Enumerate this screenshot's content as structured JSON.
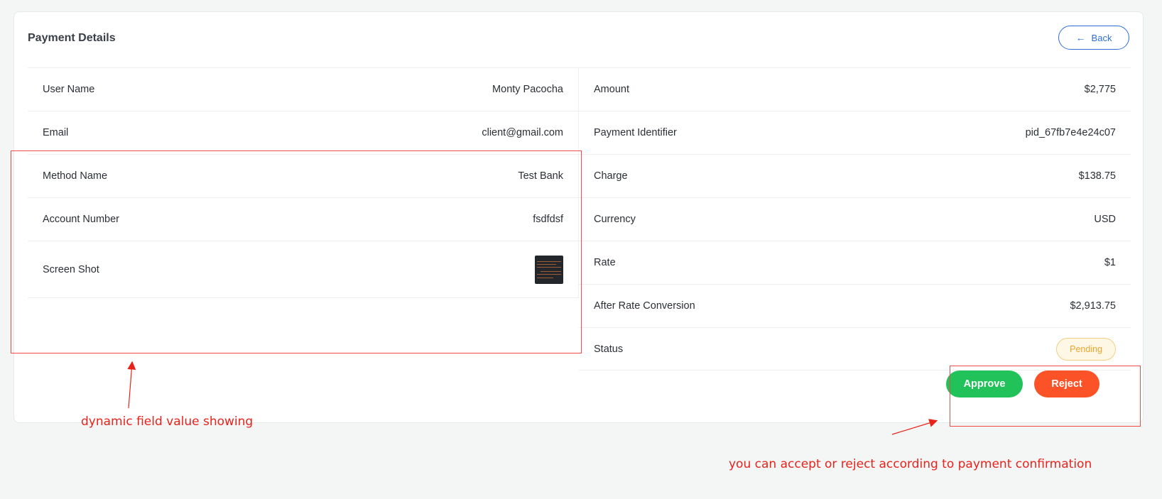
{
  "card": {
    "title": "Payment Details",
    "back_label": "Back"
  },
  "left_fields": [
    {
      "label": "User Name",
      "value": "Monty Pacocha"
    },
    {
      "label": "Email",
      "value": "client@gmail.com"
    },
    {
      "label": "Method Name",
      "value": "Test Bank"
    },
    {
      "label": "Account Number",
      "value": "fsdfdsf"
    },
    {
      "label": "Screen Shot",
      "value": ""
    }
  ],
  "right_fields": [
    {
      "label": "Amount",
      "value": "$2,775"
    },
    {
      "label": "Payment Identifier",
      "value": "pid_67fb7e4e24c07"
    },
    {
      "label": "Charge",
      "value": "$138.75"
    },
    {
      "label": "Currency",
      "value": "USD"
    },
    {
      "label": "Rate",
      "value": "$1"
    },
    {
      "label": "After Rate Conversion",
      "value": "$2,913.75"
    },
    {
      "label": "Status",
      "value": "Pending"
    }
  ],
  "actions": {
    "approve_label": "Approve",
    "reject_label": "Reject"
  },
  "annotations": {
    "dynamic_note": "dynamic field value showing",
    "action_note": "you can accept or reject according to payment confirmation"
  },
  "colors": {
    "primary": "#2f6fd6",
    "approve": "#22c25a",
    "reject": "#fb5228",
    "pending": "#eba52d",
    "annotation": "#e8231c"
  },
  "icons": {
    "back": "arrow-left-icon",
    "screenshot": "screenshot-thumbnail"
  }
}
